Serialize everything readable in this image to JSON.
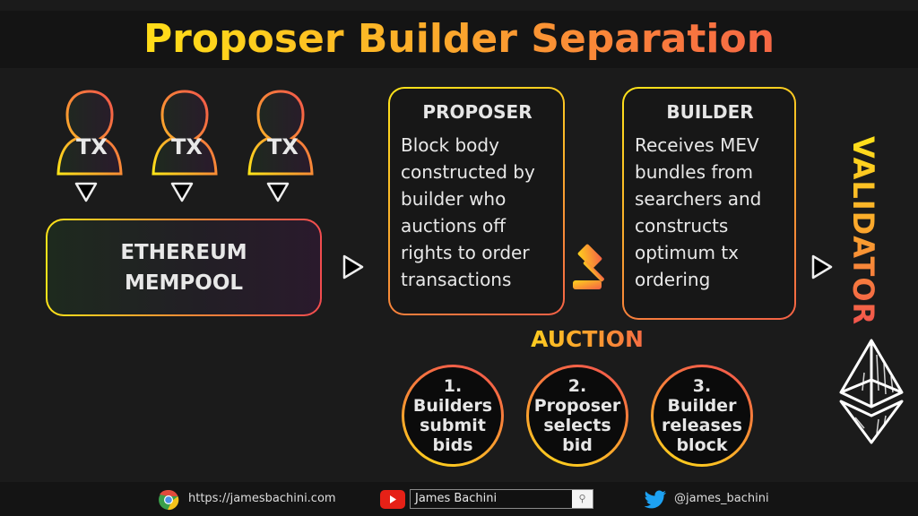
{
  "title": "Proposer Builder Separation",
  "transactions": [
    {
      "label": "TX"
    },
    {
      "label": "TX"
    },
    {
      "label": "TX"
    }
  ],
  "mempool": {
    "label": "ETHEREUM\nMEMPOOL"
  },
  "proposer": {
    "title": "PROPOSER",
    "body": "Block body\nconstructed by\nbuilder  who\nauctions off\nrights to order\ntransactions"
  },
  "builder": {
    "title": "BUILDER",
    "body": "Receives MEV\nbundles from\nsearchers and\nconstructs\noptimum tx\nordering"
  },
  "validator": {
    "label": "VALIDATOR"
  },
  "auction": {
    "label": "AUCTION",
    "steps": [
      {
        "number": "1.",
        "line1": "Builders",
        "line2": "submit",
        "line3": "bids"
      },
      {
        "number": "2.",
        "line1": "Proposer",
        "line2": "selects",
        "line3": "bid"
      },
      {
        "number": "3.",
        "line1": "Builder",
        "line2": "releases",
        "line3": "block"
      }
    ]
  },
  "icons": {
    "gavel": "gavel-icon",
    "ethereum": "ethereum-logo-icon",
    "arrow_down": "triangle-down-icon",
    "arrow_right": "triangle-right-icon"
  },
  "footer": {
    "website": "https://jamesbachini.com",
    "youtube_search_value": "James Bachini",
    "twitter": "@james_bachini"
  },
  "colors": {
    "gradient_start": "#ffef14",
    "gradient_mid": "#fba52d",
    "gradient_end": "#f2504f",
    "background": "#1b1b1b",
    "text": "#e8e8e8"
  }
}
